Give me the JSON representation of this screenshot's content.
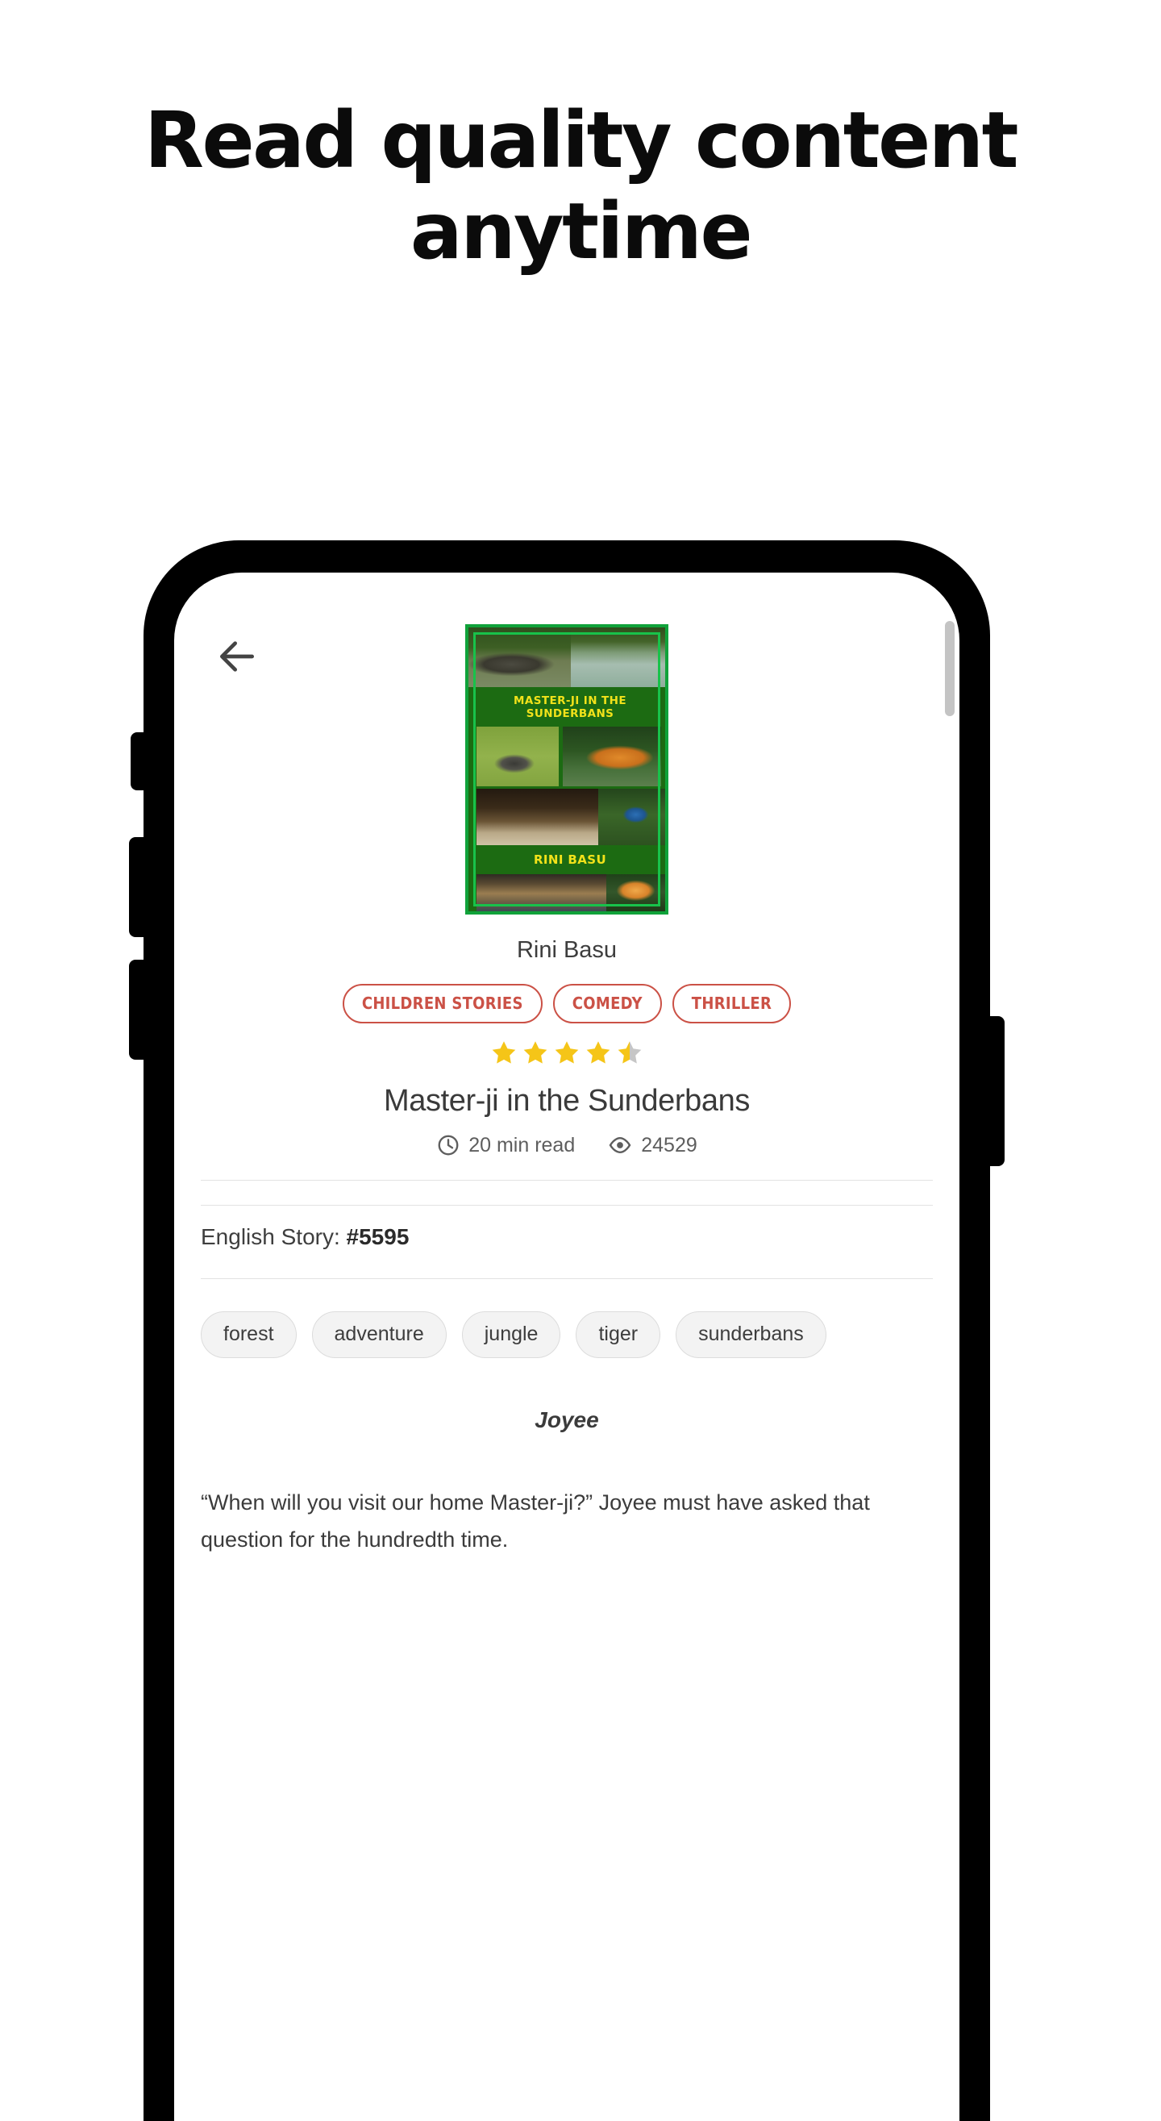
{
  "promo": {
    "headline": "Read quality content anytime"
  },
  "phone": {
    "buttons": {
      "silent": "silent-switch",
      "volume_up": "volume-up-button",
      "volume_down": "volume-down-button",
      "power": "power-button"
    }
  },
  "app": {
    "nav": {
      "back_icon": "back-arrow-icon"
    },
    "cover": {
      "title": "MASTER-JI IN THE SUNDERBANS",
      "author": "RINI BASU",
      "border_color": "#10a23a",
      "background_color": "#1c6b12",
      "text_color": "#f2e21a",
      "photos": [
        "crocodile-on-mudbank",
        "mangrove-river",
        "snake-on-grass",
        "tiger-leaping-in-water",
        "deer-among-mangrove-roots",
        "kingfisher-on-branch",
        "mangrove-roots-reflection",
        "tiger-face-closeup"
      ]
    },
    "author_name": "Rini Basu",
    "genres": [
      "CHILDREN STORIES",
      "COMEDY",
      "THRILLER"
    ],
    "genre_color": "#cb5146",
    "rating": {
      "value": 4.5,
      "max": 5,
      "full_stars": 4,
      "half_stars": 1,
      "star_color": "#f5c518",
      "empty_color": "#c6c6c6"
    },
    "story_title": "Master-ji in the Sunderbans",
    "stats": {
      "read_time_icon": "clock-icon",
      "read_time": "20 min read",
      "views_icon": "eye-icon",
      "views": "24529"
    },
    "language_line": {
      "label": "English Story:",
      "id": "#5595"
    },
    "tags": [
      "forest",
      "adventure",
      "jungle",
      "tiger",
      "sunderbans"
    ],
    "content": {
      "speaker": "Joyee",
      "paragraph": "“When will you visit our home Master-ji?” Joyee must have asked that question for the hundredth time."
    },
    "scrollbar": {
      "thumb_color": "#c4c4c4"
    }
  }
}
